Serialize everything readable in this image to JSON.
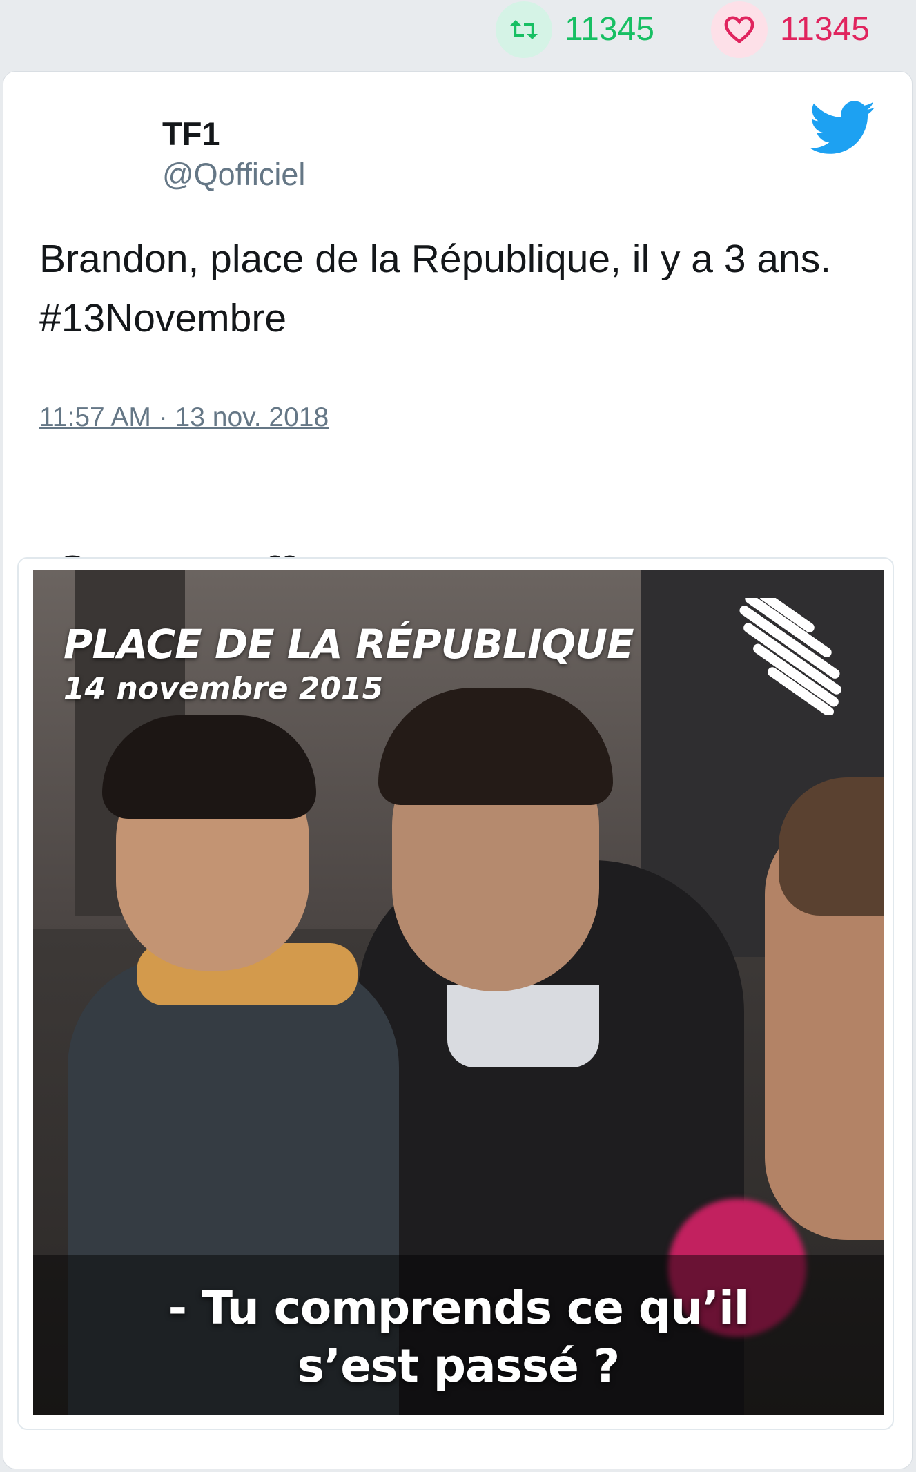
{
  "stats": {
    "retweet_count": "11345",
    "like_count": "11345",
    "retweet_color": "#17bf63",
    "like_color": "#e0245e"
  },
  "tweet": {
    "author_name": "TF1",
    "author_handle": "@Qofficiel",
    "text": "Brandon, place de la République, il y a 3 ans. #13Novembre",
    "timestamp": "11:57 AM · 13 nov. 2018",
    "brand_icon": "twitter-bird-icon",
    "brand_color": "#1da1f2"
  },
  "actions": {
    "reply_icon": "reply-icon",
    "retweet_icon": "retweet-icon",
    "like_icon": "heart-icon"
  },
  "media": {
    "overlay_title": "PLACE DE LA RÉPUBLIQUE",
    "overlay_date": "14 novembre 2015",
    "subtitle_line1": "- Tu comprends ce qu’il",
    "subtitle_line2": "s’est passé ?",
    "logo_icon": "striped-logo-icon"
  }
}
